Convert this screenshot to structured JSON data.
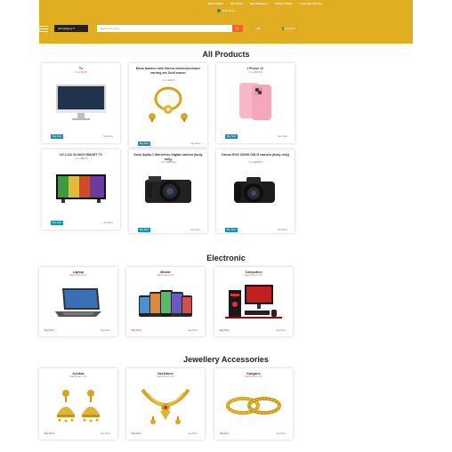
{
  "colors": {
    "header": "#e1ad21",
    "buy_button": "#1b8fb0",
    "search_button": "#f26522",
    "accent_red": "#e84a3c"
  },
  "header": {
    "top_links": [
      "Best Sellers",
      "Gift Ideas",
      "New Releases",
      "Today's Deals",
      "Customer Service"
    ],
    "logo_text": "Best Store",
    "category_button": "All Category",
    "search_placeholder": "Search this blog",
    "cart_label": "Cart",
    "account_label": "Account"
  },
  "sections": [
    {
      "title": "All Products",
      "products": [
        {
          "name": "Tv",
          "price_prefix": "Price",
          "price": "$30 $",
          "image": "imac-icon",
          "buy": "Buy Now",
          "more": "See More"
        },
        {
          "name": "Mens fashion mini Sterea choker(necklace earring set Gold warrer",
          "price_prefix": "Price",
          "price": "$100 $",
          "image": "gold-jewellery-set-icon",
          "buy": "Buy Now",
          "more": "See More"
        },
        {
          "name": "i Phone 12",
          "price_prefix": "Price",
          "price": "$50.0 $",
          "image": "iphone-icon",
          "buy": "Buy Now",
          "more": "See More"
        },
        {
          "name": "LG L122 32 INCH SMART TV",
          "price_prefix": "Price",
          "price": "$500 $",
          "image": "smart-tv-icon",
          "buy": "Buy Now",
          "more": "See More"
        },
        {
          "name": "Sony Alpha 1 Mirrorless Digital camera (body only)",
          "price_prefix": "Price",
          "price": "$8500 $",
          "image": "mirrorless-camera-icon",
          "buy": "Buy Now",
          "more": "See More"
        },
        {
          "name": "Canon EOS 2000D DSLR camera (body only)",
          "price_prefix": "Price",
          "price": "$2500 $",
          "image": "dslr-camera-icon",
          "buy": "Buy Now",
          "more": "See More"
        }
      ]
    },
    {
      "title": "Electronic",
      "products": [
        {
          "name": "Laptop",
          "price_prefix": "Start Price",
          "price": "$ 100",
          "image": "laptop-icon",
          "buy": "Buy Now",
          "more": "See More"
        },
        {
          "name": "Mobile",
          "price_prefix": "Start Price",
          "price": "$ 100",
          "image": "mobile-phones-icon",
          "buy": "Buy Now",
          "more": "See More"
        },
        {
          "name": "Computers",
          "price_prefix": "Start Price",
          "price": "$ 100",
          "image": "gaming-computer-icon",
          "buy": "Buy Now",
          "more": "See More"
        }
      ]
    },
    {
      "title": "Jewellery Accessories",
      "products": [
        {
          "name": "Jumkas",
          "price_prefix": "Start Price",
          "price": "$ 100",
          "image": "earrings-icon",
          "buy": "Buy Now",
          "more": "See More"
        },
        {
          "name": "Necklaces",
          "price_prefix": "Start Price",
          "price": "$ 100",
          "image": "necklace-icon",
          "buy": "Buy Now",
          "more": "See More"
        },
        {
          "name": "Kangans",
          "price_prefix": "Start Price",
          "price": "$ 100",
          "image": "bangles-icon",
          "buy": "Buy Now",
          "more": "See More"
        }
      ]
    }
  ]
}
